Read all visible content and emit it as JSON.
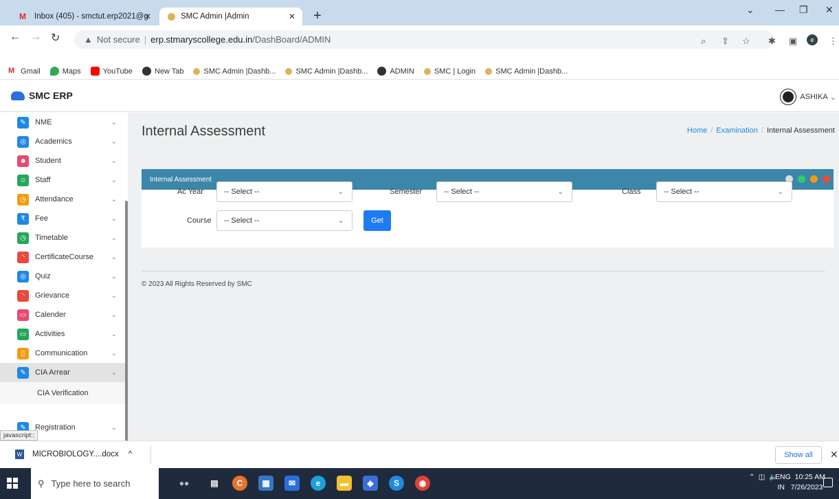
{
  "browser": {
    "tabs": [
      {
        "label": "Inbox (405) - smctut.erp2021@g",
        "icon": "gmail-icon",
        "active": false
      },
      {
        "label": "SMC Admin |Admin",
        "icon": "smc-favicon",
        "active": true
      }
    ],
    "url": {
      "warning": "Not secure",
      "host": "erp.stmaryscollege.edu.in",
      "path": "/DashBoard/ADMIN"
    },
    "bookmarks": [
      "Gmail",
      "Maps",
      "YouTube",
      "New Tab",
      "SMC Admin |Dashb...",
      "SMC Admin |Dashb...",
      "ADMIN",
      "SMC | Login",
      "SMC Admin |Dashb..."
    ]
  },
  "app": {
    "logo": "SMC ERP",
    "user": "ASHIKA"
  },
  "sidebar": {
    "items": [
      {
        "label": "NME",
        "icon": "edit-icon",
        "color": "#1e88e5"
      },
      {
        "label": "Academics",
        "icon": "circle-icon",
        "color": "#1e88e5"
      },
      {
        "label": "Student",
        "icon": "users-icon",
        "color": "#e84a6f"
      },
      {
        "label": "Staff",
        "icon": "user-icon",
        "color": "#26a65b"
      },
      {
        "label": "Attendance",
        "icon": "clock-icon",
        "color": "#f39c12"
      },
      {
        "label": "Fee",
        "icon": "rupee-icon",
        "color": "#1e88e5"
      },
      {
        "label": "Timetable",
        "icon": "clock-icon",
        "color": "#26a65b"
      },
      {
        "label": "CertificateCourse",
        "icon": "rss-icon",
        "color": "#e84a3c"
      },
      {
        "label": "Quiz",
        "icon": "circle-icon",
        "color": "#1e88e5"
      },
      {
        "label": "Grievance",
        "icon": "rss-icon",
        "color": "#e84a3c"
      },
      {
        "label": "Calender",
        "icon": "calendar-icon",
        "color": "#e84a6f"
      },
      {
        "label": "Activities",
        "icon": "calendar-icon",
        "color": "#26a65b"
      },
      {
        "label": "Communication",
        "icon": "book-icon",
        "color": "#f39c12"
      },
      {
        "label": "CIA Arrear",
        "icon": "edit-icon",
        "color": "#1e88e5"
      }
    ],
    "sub_item": "CIA Verification",
    "last_item": "Registration"
  },
  "main": {
    "title": "Internal Assessment",
    "breadcrumb": [
      "Home",
      "Examination",
      "Internal Assessment"
    ],
    "card_title": "Internal Assessment",
    "fields": {
      "ac_year": {
        "label": "Ac Year",
        "value": "-- Select --"
      },
      "semester": {
        "label": "Semester",
        "value": "-- Select --"
      },
      "class": {
        "label": "Class",
        "value": "-- Select --"
      },
      "course": {
        "label": "Course",
        "value": "-- Select --"
      }
    },
    "get_label": "Get",
    "footer": "© 2023 All Rights Reserved by SMC"
  },
  "status_tip": "javascript:;",
  "downloads": {
    "file": "MICROBIOLOGY....docx",
    "show_all": "Show all"
  },
  "taskbar": {
    "search_placeholder": "Type here to search",
    "lang": "ENG",
    "region": "IN",
    "time": "10:25 AM",
    "date": "7/26/2023"
  }
}
